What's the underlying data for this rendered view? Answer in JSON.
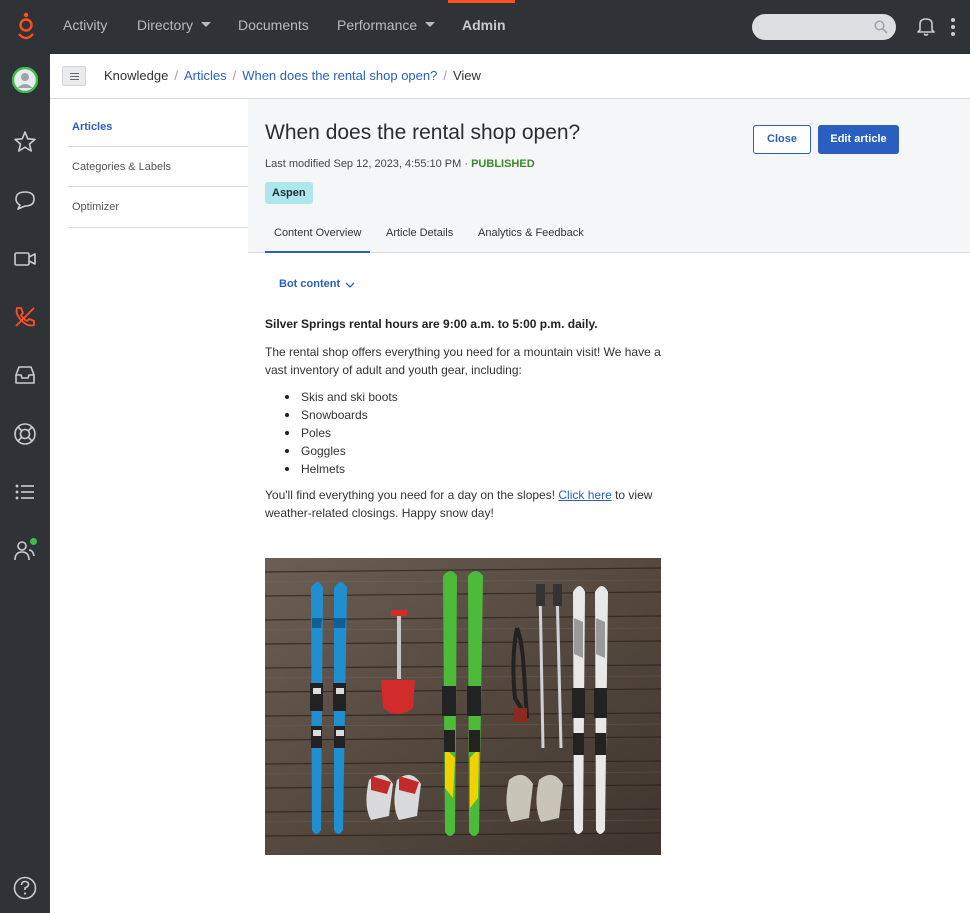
{
  "nav": {
    "items": [
      {
        "label": "Activity",
        "caret": false
      },
      {
        "label": "Directory",
        "caret": true
      },
      {
        "label": "Documents",
        "caret": false
      },
      {
        "label": "Performance",
        "caret": true
      },
      {
        "label": "Admin",
        "caret": false,
        "active": true
      }
    ],
    "accent": "#ff4f1f"
  },
  "rail": {
    "icons": [
      "avatar-icon",
      "star-icon",
      "chat-icon",
      "video-icon",
      "phone-off-icon",
      "inbox-icon",
      "lifebuoy-icon",
      "list-icon",
      "people-icon",
      "help-icon"
    ]
  },
  "breadcrumb": {
    "root": "Knowledge",
    "articles": "Articles",
    "article": "When does the rental shop open?",
    "current": "View"
  },
  "sidebar": {
    "items": [
      {
        "label": "Articles"
      },
      {
        "label": "Categories & Labels"
      },
      {
        "label": "Optimizer"
      }
    ]
  },
  "article": {
    "title": "When does the rental shop open?",
    "modified": "Last modified Sep 12, 2023, 4:55:10 PM ·",
    "status": "PUBLISHED",
    "tag": "Aspen",
    "close_label": "Close",
    "edit_label": "Edit article",
    "tabs": [
      {
        "label": "Content Overview"
      },
      {
        "label": "Article Details"
      },
      {
        "label": "Analytics & Feedback"
      }
    ]
  },
  "content": {
    "toggle_label": "Bot content",
    "headline": "Silver Springs rental hours are 9:00 a.m. to 5:00 p.m. daily.",
    "intro": "The rental shop offers everything you need for a mountain visit! We have a vast inventory of adult and youth gear, including:",
    "list": [
      "Skis and ski boots",
      "Snowboards",
      "Poles",
      "Goggles",
      "Helmets"
    ],
    "outro_before": "You'll find everything you need for a day on the slopes!",
    "link": "Click here",
    "outro_after": "to view weather-related closings. Happy snow day!"
  }
}
